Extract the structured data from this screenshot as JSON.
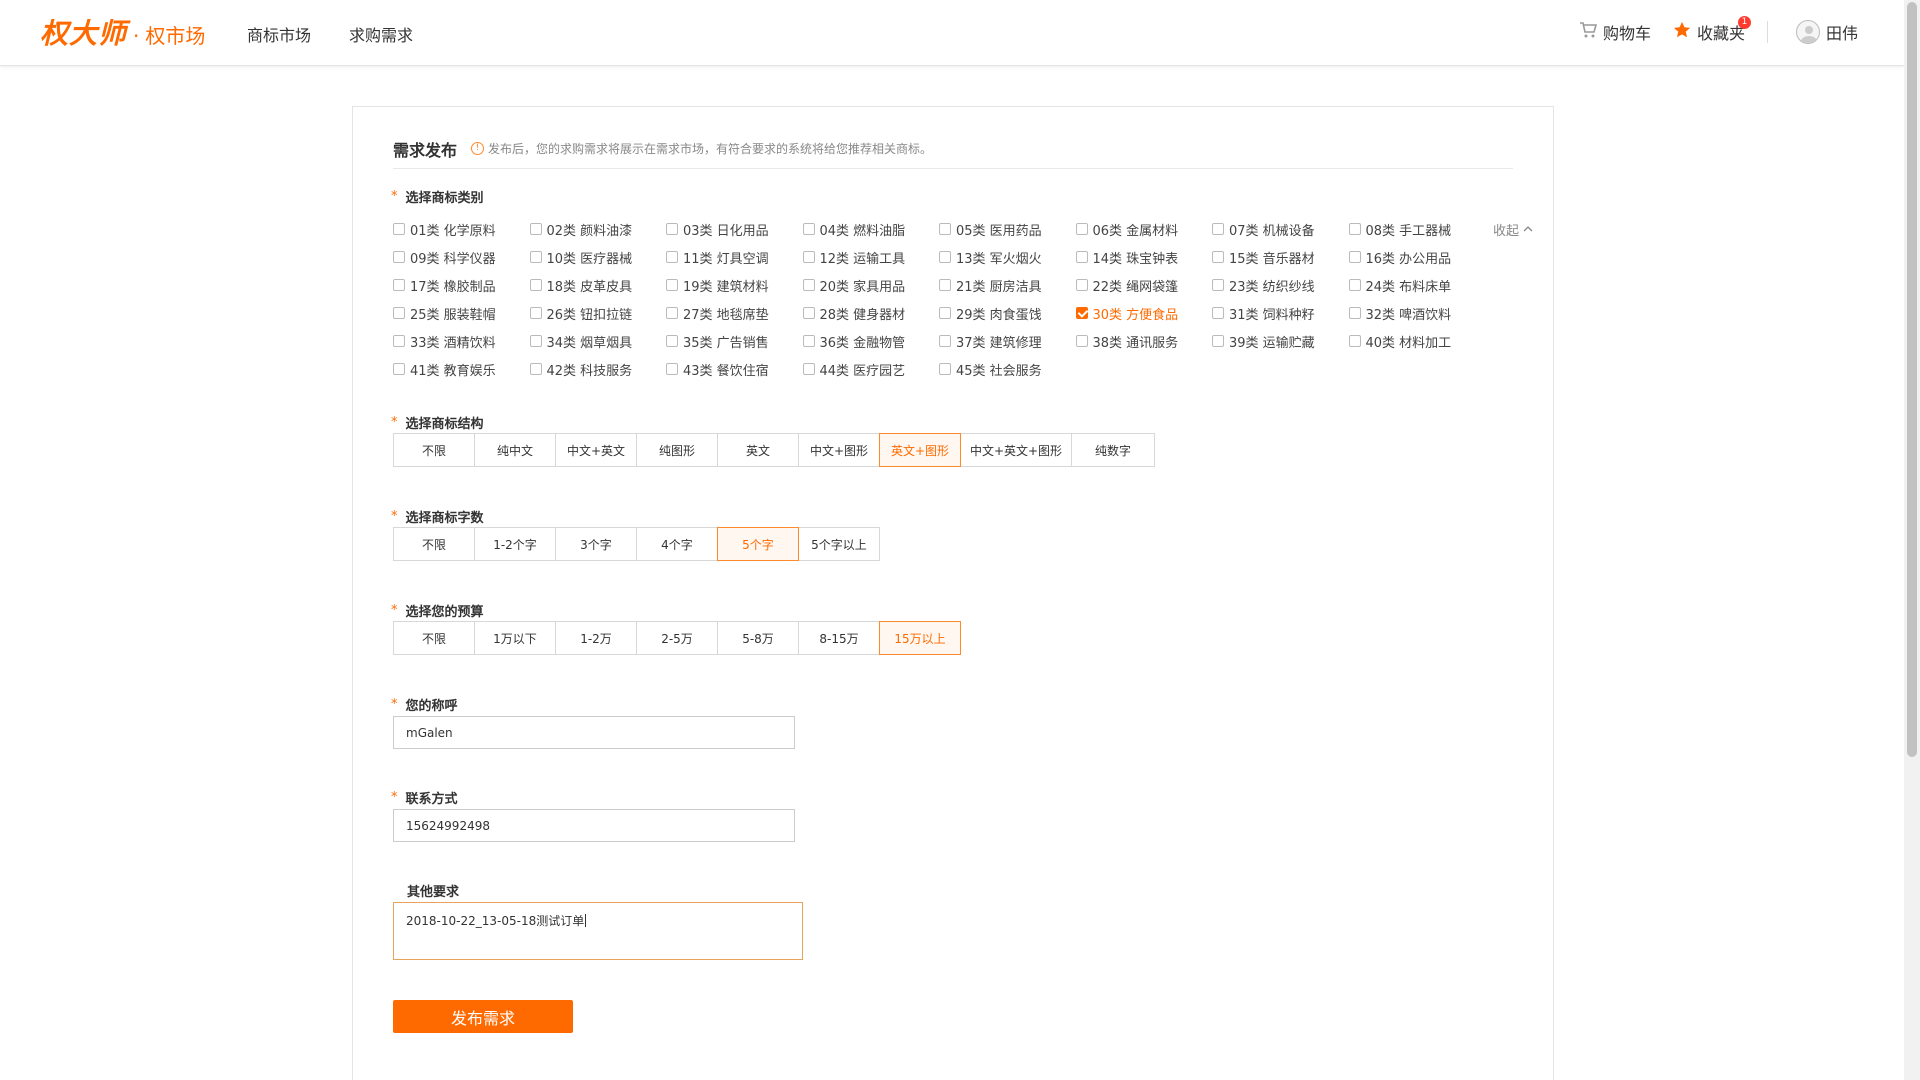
{
  "header": {
    "logo_main": "权大师",
    "logo_dot": "·",
    "logo_sub": "权市场",
    "nav": [
      "商标市场",
      "求购需求"
    ],
    "cart_label": "购物车",
    "favorites_label": "收藏夹",
    "favorites_badge": "1",
    "user_name": "田伟"
  },
  "form": {
    "title": "需求发布",
    "note": "发布后，您的求购需求将展示在需求市场，有符合要求的系统将给您推荐相关商标。",
    "category_label": "选择商标类别",
    "collapse_label": "收起",
    "categories": [
      "01类 化学原料",
      "02类 颜料油漆",
      "03类 日化用品",
      "04类 燃料油脂",
      "05类 医用药品",
      "06类 金属材料",
      "07类 机械设备",
      "08类 手工器械",
      "09类 科学仪器",
      "10类 医疗器械",
      "11类 灯具空调",
      "12类 运输工具",
      "13类 军火烟火",
      "14类 珠宝钟表",
      "15类 音乐器材",
      "16类 办公用品",
      "17类 橡胶制品",
      "18类 皮革皮具",
      "19类 建筑材料",
      "20类 家具用品",
      "21类 厨房洁具",
      "22类 绳网袋篷",
      "23类 纺织纱线",
      "24类 布料床单",
      "25类 服装鞋帽",
      "26类 钮扣拉链",
      "27类 地毯席垫",
      "28类 健身器材",
      "29类 肉食蛋饯",
      "30类 方便食品",
      "31类 饲料种籽",
      "32类 啤酒饮料",
      "33类 酒精饮料",
      "34类 烟草烟具",
      "35类 广告销售",
      "36类 金融物管",
      "37类 建筑修理",
      "38类 通讯服务",
      "39类 运输贮藏",
      "40类 材料加工",
      "41类 教育娱乐",
      "42类 科技服务",
      "43类 餐饮住宿",
      "44类 医疗园艺",
      "45类 社会服务"
    ],
    "checked_category": "30类 方便食品",
    "structure_label": "选择商标结构",
    "structure_options": [
      "不限",
      "纯中文",
      "中文+英文",
      "纯图形",
      "英文",
      "中文+图形",
      "英文+图形",
      "中文+英文+图形",
      "纯数字"
    ],
    "structure_selected": "英文+图形",
    "chars_label": "选择商标字数",
    "chars_options": [
      "不限",
      "1-2个字",
      "3个字",
      "4个字",
      "5个字",
      "5个字以上"
    ],
    "chars_selected": "5个字",
    "budget_label": "选择您的预算",
    "budget_options": [
      "不限",
      "1万以下",
      "1-2万",
      "2-5万",
      "5-8万",
      "8-15万",
      "15万以上"
    ],
    "budget_selected": "15万以上",
    "name_label": "您的称呼",
    "name_value": "mGalen",
    "contact_label": "联系方式",
    "contact_value": "15624992498",
    "other_label": "其他要求",
    "other_value": "2018-10-22_13-05-18测试订单",
    "submit_label": "发布需求"
  },
  "colors": {
    "accent": "#ff6a00",
    "selected_border": "#ff8a2b"
  }
}
